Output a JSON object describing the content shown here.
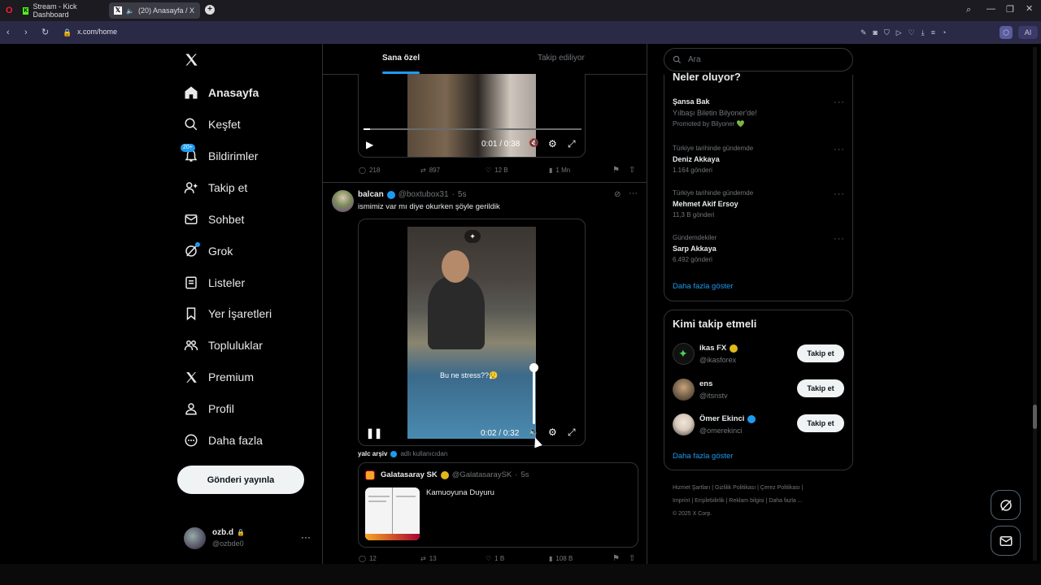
{
  "browser": {
    "tabs": [
      {
        "title": "Stream - Kick Dashboard",
        "icon": "kick-icon"
      },
      {
        "title": "(20) Anasayfa / X",
        "icon": "x-icon"
      }
    ],
    "url": "x.com/home",
    "ai_label": "AI"
  },
  "nav": {
    "items": [
      {
        "label": "Anasayfa",
        "icon": "home-icon"
      },
      {
        "label": "Keşfet",
        "icon": "search-icon"
      },
      {
        "label": "Bildirimler",
        "icon": "bell-icon",
        "badge": "20+"
      },
      {
        "label": "Takip et",
        "icon": "add-person-icon"
      },
      {
        "label": "Sohbet",
        "icon": "mail-icon"
      },
      {
        "label": "Grok",
        "icon": "grok-icon"
      },
      {
        "label": "Listeler",
        "icon": "list-icon"
      },
      {
        "label": "Yer İşaretleri",
        "icon": "bookmark-icon"
      },
      {
        "label": "Topluluklar",
        "icon": "people-icon"
      },
      {
        "label": "Premium",
        "icon": "x-icon"
      },
      {
        "label": "Profil",
        "icon": "person-icon"
      },
      {
        "label": "Daha fazla",
        "icon": "more-circle-icon"
      }
    ],
    "post_button": "Gönderi yayınla",
    "account": {
      "name": "ozb.d",
      "handle": "@ozbde0"
    }
  },
  "timeline": {
    "tabs": [
      "Sana özel",
      "Takip ediliyor"
    ],
    "post1": {
      "video_time": "0:01 / 0:38",
      "stats": {
        "replies": "218",
        "reposts": "897",
        "likes": "12 B",
        "views": "1 Mn"
      }
    },
    "post2": {
      "author": "balcan",
      "handle": "@boxtubox31",
      "time": "5s",
      "text": "ismimiz var mı diye okurken şöyle gerildik",
      "video_time": "0:02 / 0:32",
      "video_caption": "Bu ne stress??😮‍💨",
      "credit_name": "yalc arşiv",
      "credit_suffix": "adlı kullanıcıdan",
      "quote": {
        "author": "Galatasaray SK",
        "handle": "@GalatasaraySK",
        "time": "5s",
        "text": "Kamuoyuna Duyuru"
      },
      "stats": {
        "replies": "12",
        "reposts": "13",
        "likes": "1 B",
        "views": "108 B"
      }
    }
  },
  "search": {
    "placeholder": "Ara"
  },
  "trends": {
    "heading": "Neler oluyor?",
    "items": [
      {
        "meta": "",
        "title": "Şansa Bak",
        "sub": "Yılbaşı Biletin Bilyoner'de!",
        "extra": "Promoted by Bilyoner 💚"
      },
      {
        "meta": "Türkiye tarihinde gündemde",
        "title": "Deniz Akkaya",
        "sub": "1.164 gönderi",
        "extra": ""
      },
      {
        "meta": "Türkiye tarihinde gündemde",
        "title": "Mehmet Akif Ersoy",
        "sub": "11,3 B gönderi",
        "extra": ""
      },
      {
        "meta": "Gündemdekiler",
        "title": "Sarp Akkaya",
        "sub": "6.492 gönderi",
        "extra": ""
      }
    ],
    "show_more": "Daha fazla göster"
  },
  "who_to_follow": {
    "heading": "Kimi takip etmeli",
    "items": [
      {
        "name": "ikas FX",
        "handle": "@ikasforex",
        "button": "Takip et"
      },
      {
        "name": "ens",
        "handle": "@itsnstv",
        "button": "Takip et"
      },
      {
        "name": "Ömer Ekinci",
        "handle": "@omerekinci",
        "button": "Takip et"
      }
    ],
    "show_more": "Daha fazla göster"
  },
  "footer": {
    "links": [
      "Hizmet Şartları",
      "Gizlilik Politikası",
      "Çerez Politikası",
      "Imprint",
      "Erişilebilirlik",
      "Reklam bilgisi",
      "Daha fazla ..."
    ],
    "copyright": "© 2025 X Corp."
  },
  "colors": {
    "accent": "#1d9bf0",
    "background": "#000000",
    "border": "#2f3336",
    "muted": "#71767b"
  }
}
